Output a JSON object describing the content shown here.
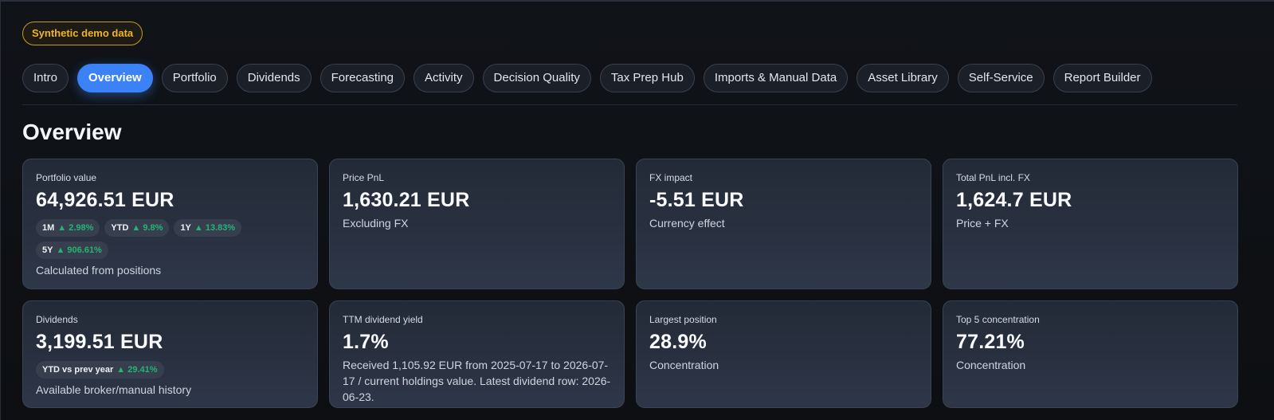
{
  "badge": "Synthetic demo data",
  "tabs": [
    {
      "label": "Intro"
    },
    {
      "label": "Overview"
    },
    {
      "label": "Portfolio"
    },
    {
      "label": "Dividends"
    },
    {
      "label": "Forecasting"
    },
    {
      "label": "Activity"
    },
    {
      "label": "Decision Quality"
    },
    {
      "label": "Tax Prep Hub"
    },
    {
      "label": "Imports & Manual Data"
    },
    {
      "label": "Asset Library"
    },
    {
      "label": "Self-Service"
    },
    {
      "label": "Report Builder"
    }
  ],
  "active_tab": "Overview",
  "page_title": "Overview",
  "cards": {
    "portfolio_value": {
      "label": "Portfolio value",
      "value": "64,926.51 EUR",
      "pills": [
        {
          "key": "1M",
          "val": "▲ 2.98%"
        },
        {
          "key": "YTD",
          "val": "▲ 9.8%"
        },
        {
          "key": "1Y",
          "val": "▲ 13.83%"
        },
        {
          "key": "5Y",
          "val": "▲ 906.61%"
        }
      ],
      "sub": "Calculated from positions"
    },
    "price_pnl": {
      "label": "Price PnL",
      "value": "1,630.21 EUR",
      "sub": "Excluding FX"
    },
    "fx_impact": {
      "label": "FX impact",
      "value": "-5.51 EUR",
      "sub": "Currency effect"
    },
    "total_pnl": {
      "label": "Total PnL incl. FX",
      "value": "1,624.7 EUR",
      "sub": "Price + FX"
    },
    "dividends": {
      "label": "Dividends",
      "value": "3,199.51 EUR",
      "pills": [
        {
          "key": "YTD vs prev year",
          "val": "▲ 29.41%"
        }
      ],
      "sub": "Available broker/manual history"
    },
    "ttm_yield": {
      "label": "TTM dividend yield",
      "value": "1.7%",
      "sub": "Received 1,105.92 EUR from 2025-07-17 to 2026-07-17 / current holdings value. Latest dividend row: 2026-06-23."
    },
    "largest_position": {
      "label": "Largest position",
      "value": "28.9%",
      "sub": "Concentration"
    },
    "top5": {
      "label": "Top 5 concentration",
      "value": "77.21%",
      "sub": "Concentration"
    }
  },
  "colors": {
    "accent": "#3b82f6",
    "positive": "#22b573",
    "badge": "#f2b51d"
  }
}
